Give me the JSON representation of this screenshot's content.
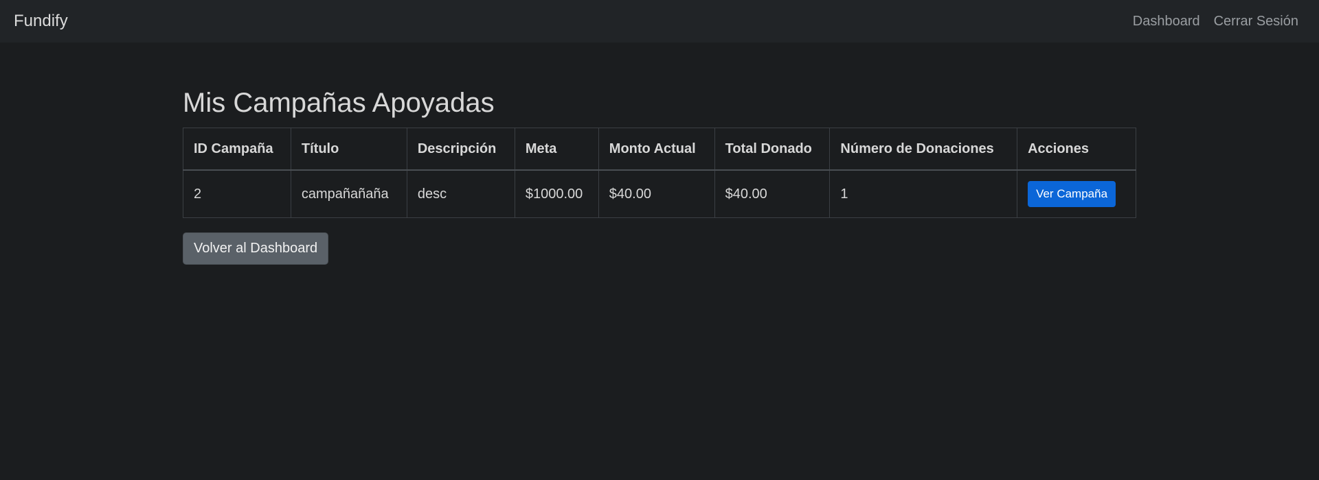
{
  "navbar": {
    "brand": "Fundify",
    "links": [
      "Dashboard",
      "Cerrar Sesión"
    ]
  },
  "page": {
    "title": "Mis Campañas Apoyadas"
  },
  "table": {
    "headers": [
      "ID Campaña",
      "Título",
      "Descripción",
      "Meta",
      "Monto Actual",
      "Total Donado",
      "Número de Donaciones",
      "Acciones"
    ],
    "rows": [
      {
        "id": "2",
        "title": "campañañaña",
        "description": "desc",
        "goal": "$1000.00",
        "current_amount": "$40.00",
        "total_donated": "$40.00",
        "donations_count": "1",
        "action_label": "Ver Campaña"
      }
    ]
  },
  "back_button": {
    "label": "Volver al Dashboard"
  },
  "colors": {
    "background": "#1b1d1f",
    "navbar": "#212427",
    "primary": "#0b66d8",
    "secondary": "#5a6168"
  }
}
